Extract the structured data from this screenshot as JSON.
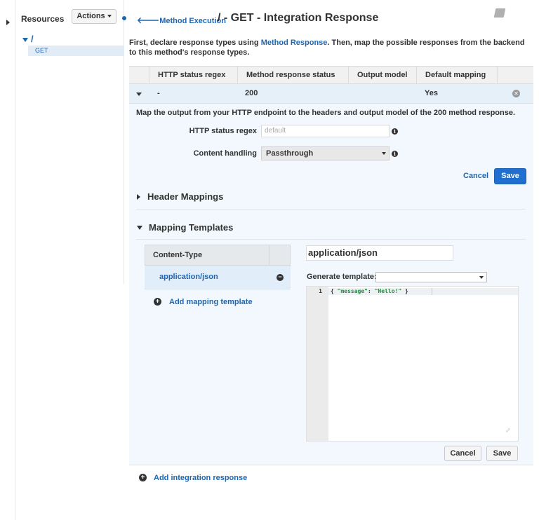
{
  "sidebar": {
    "title": "Resources",
    "actions_label": "Actions",
    "tree": {
      "root": "/",
      "method": "GET"
    }
  },
  "header": {
    "back_link": "Method Execution",
    "title": "/ - GET - Integration Response"
  },
  "intro": {
    "before": "First, declare response types using ",
    "link": "Method Response",
    "after": ". Then, map the possible responses from the backend to this method's response types."
  },
  "table": {
    "columns": [
      "HTTP status regex",
      "Method response status",
      "Output model",
      "Default mapping"
    ],
    "row": {
      "regex": "-",
      "status": "200",
      "model": "",
      "default": "Yes"
    }
  },
  "detail": {
    "description": "Map the output from your HTTP endpoint to the headers and output model of the 200 method response.",
    "regex_label": "HTTP status regex",
    "regex_placeholder": "default",
    "content_handling_label": "Content handling",
    "content_handling_value": "Passthrough",
    "cancel": "Cancel",
    "save": "Save"
  },
  "header_mappings": {
    "title": "Header Mappings"
  },
  "mapping_templates": {
    "title": "Mapping Templates",
    "content_type_header": "Content-Type",
    "content_types": [
      "application/json"
    ],
    "add_template": "Add mapping template",
    "selected_content_type": "application/json",
    "generate_label": "Generate template:",
    "generate_value": "",
    "code_line_number": "1",
    "code_open": "{ ",
    "code_key": "\"message\"",
    "code_colon": ": ",
    "code_value": "\"Hello!\"",
    "code_close": " }",
    "cancel": "Cancel",
    "save": "Save"
  },
  "footer": {
    "add_integration": "Add integration response"
  },
  "colors": {
    "link": "#1f66b0",
    "primary": "#1f6fd0",
    "row_highlight": "#e6f0f9",
    "panel": "#f2f8fd"
  },
  "icons": [
    "book-icon",
    "info-icon",
    "remove-icon",
    "minus-icon",
    "plus-icon",
    "expand-icon",
    "back-arrow-icon"
  ]
}
